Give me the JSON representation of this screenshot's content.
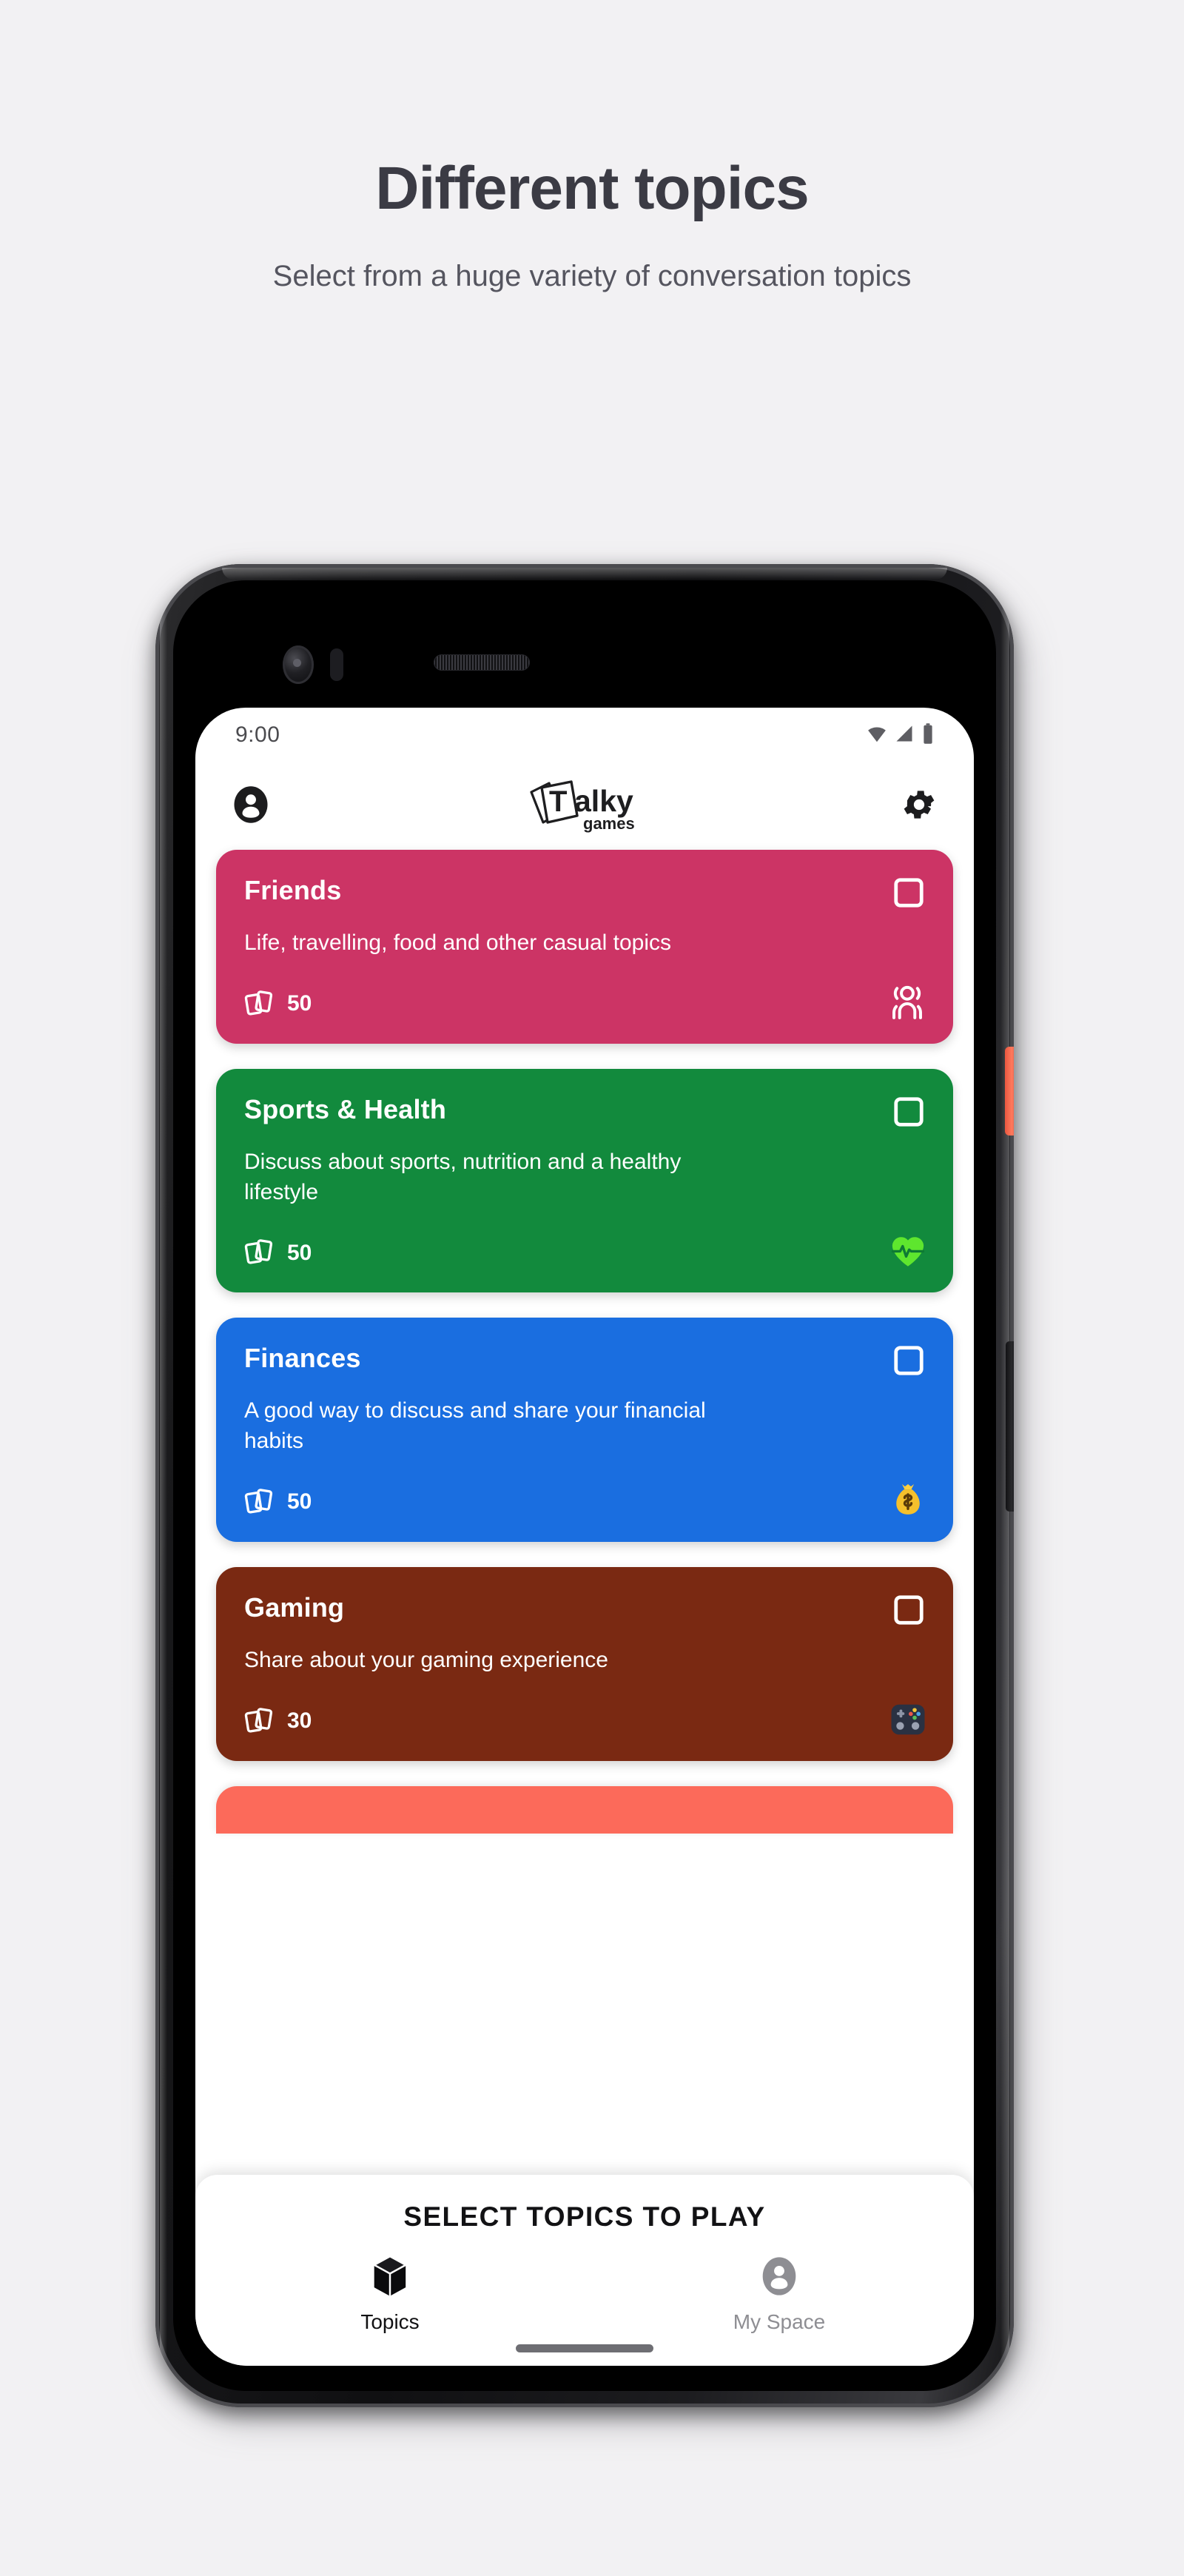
{
  "promo": {
    "title": "Different topics",
    "subtitle": "Select from a huge variety of conversation topics"
  },
  "phone": {
    "status_bar": {
      "time": "9:00",
      "icons": [
        "wifi-icon",
        "signal-icon",
        "battery-icon"
      ]
    },
    "app_bar": {
      "profile_icon": "account-circle-icon",
      "logo_primary": "T",
      "logo_text": "alky",
      "logo_sub": "games",
      "settings_icon": "gear-icon"
    }
  },
  "topics": [
    {
      "title": "Friends",
      "description": "Life, travelling, food and other casual topics",
      "count": "50",
      "color": "#cc3465",
      "emoji_name": "speaking-head-icon",
      "emoji_style": "outline",
      "checked": false
    },
    {
      "title": "Sports & Health",
      "description": "Discuss about sports, nutrition and a healthy lifestyle",
      "count": "50",
      "color": "#128a3d",
      "emoji_name": "beating-heart-pulse-icon",
      "emoji_style": "color",
      "emoji_glyph": "💚",
      "checked": false
    },
    {
      "title": "Finances",
      "description": "A good way to discuss and share your financial habits",
      "count": "50",
      "color": "#1a6ee0",
      "emoji_name": "money-bag-icon",
      "emoji_style": "color",
      "emoji_glyph": "💰",
      "checked": false
    },
    {
      "title": "Gaming",
      "description": "Share about your gaming experience",
      "count": "30",
      "color": "#7a2912",
      "emoji_name": "video-game-controller-icon",
      "emoji_style": "color",
      "emoji_glyph": "🎮",
      "checked": false
    }
  ],
  "peek_card": {
    "color": "#fc6a5a"
  },
  "bottom_sheet": {
    "title": "SELECT TOPICS TO PLAY",
    "nav": [
      {
        "label": "Topics",
        "icon": "cube-icon",
        "active": true
      },
      {
        "label": "My Space",
        "icon": "account-circle-icon",
        "active": false
      }
    ]
  },
  "colors": {
    "page_bg": "#f2f1f3",
    "heading": "#3b3b44",
    "accent_peek": "#fc6a5a",
    "nav_active": "#111113",
    "nav_inactive": "#8e8e93"
  }
}
